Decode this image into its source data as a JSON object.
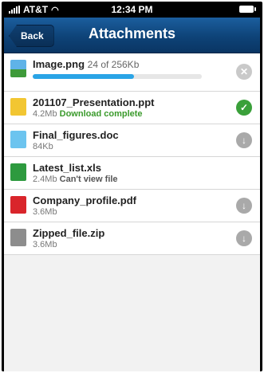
{
  "status": {
    "carrier": "AT&T",
    "time": "12:34 PM"
  },
  "nav": {
    "back_label": "Back",
    "title": "Attachments"
  },
  "items": [
    {
      "name": "Image.png",
      "progress_text": "24 of 256Kb",
      "sub": "",
      "status_text": "",
      "icon": "image-file-icon",
      "action_icon": "cancel-icon",
      "progress": 0.6
    },
    {
      "name": "201107_Presentation.ppt",
      "progress_text": "",
      "sub": "4.2Mb",
      "status_text": "Download complete",
      "icon": "ppt-file-icon",
      "action_icon": "checkmark-icon"
    },
    {
      "name": "Final_figures.doc",
      "progress_text": "",
      "sub": "84Kb",
      "status_text": "",
      "icon": "doc-file-icon",
      "action_icon": "download-icon"
    },
    {
      "name": "Latest_list.xls",
      "progress_text": "",
      "sub": "2.4Mb",
      "status_text": "Can't view file",
      "icon": "xls-file-icon",
      "action_icon": ""
    },
    {
      "name": "Company_profile.pdf",
      "progress_text": "",
      "sub": "3.6Mb",
      "status_text": "",
      "icon": "pdf-file-icon",
      "action_icon": "download-icon"
    },
    {
      "name": "Zipped_file.zip",
      "progress_text": "",
      "sub": "3.6Mb",
      "status_text": "",
      "icon": "zip-file-icon",
      "action_icon": "download-icon"
    }
  ]
}
